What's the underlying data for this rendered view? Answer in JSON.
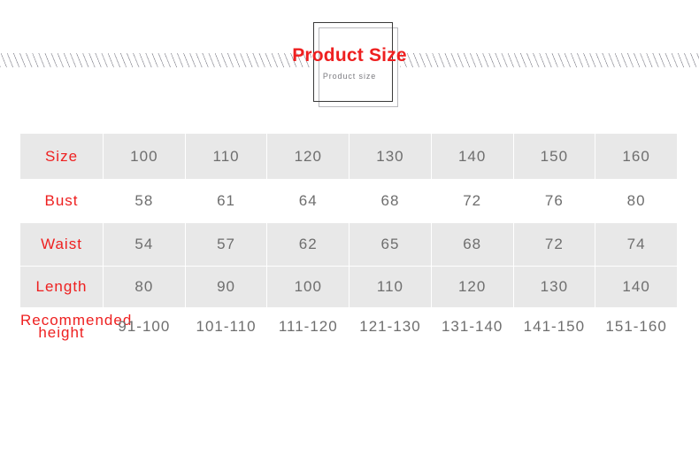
{
  "banner": {
    "title": "Product Size",
    "subtitle": "Product  size",
    "title_color": "#ee2020",
    "hatch_color": "#9a9aa2"
  },
  "table": {
    "label_color": "#ee2020",
    "value_color": "#6e6e6e",
    "shaded_row_color": "#e8e8e8",
    "plain_row_color": "#ffffff",
    "rows": [
      {
        "label": "Size",
        "values": [
          "100",
          "110",
          "120",
          "130",
          "140",
          "150",
          "160"
        ]
      },
      {
        "label": "Bust",
        "values": [
          "58",
          "61",
          "64",
          "68",
          "72",
          "76",
          "80"
        ]
      },
      {
        "label": "Waist",
        "values": [
          "54",
          "57",
          "62",
          "65",
          "68",
          "72",
          "74"
        ]
      },
      {
        "label": "Length",
        "values": [
          "80",
          "90",
          "100",
          "110",
          "120",
          "130",
          "140"
        ]
      },
      {
        "label_line1": "Recommended",
        "label_line2": "height",
        "values": [
          "91-100",
          "101-110",
          "111-120",
          "121-130",
          "131-140",
          "141-150",
          "151-160"
        ]
      }
    ]
  }
}
